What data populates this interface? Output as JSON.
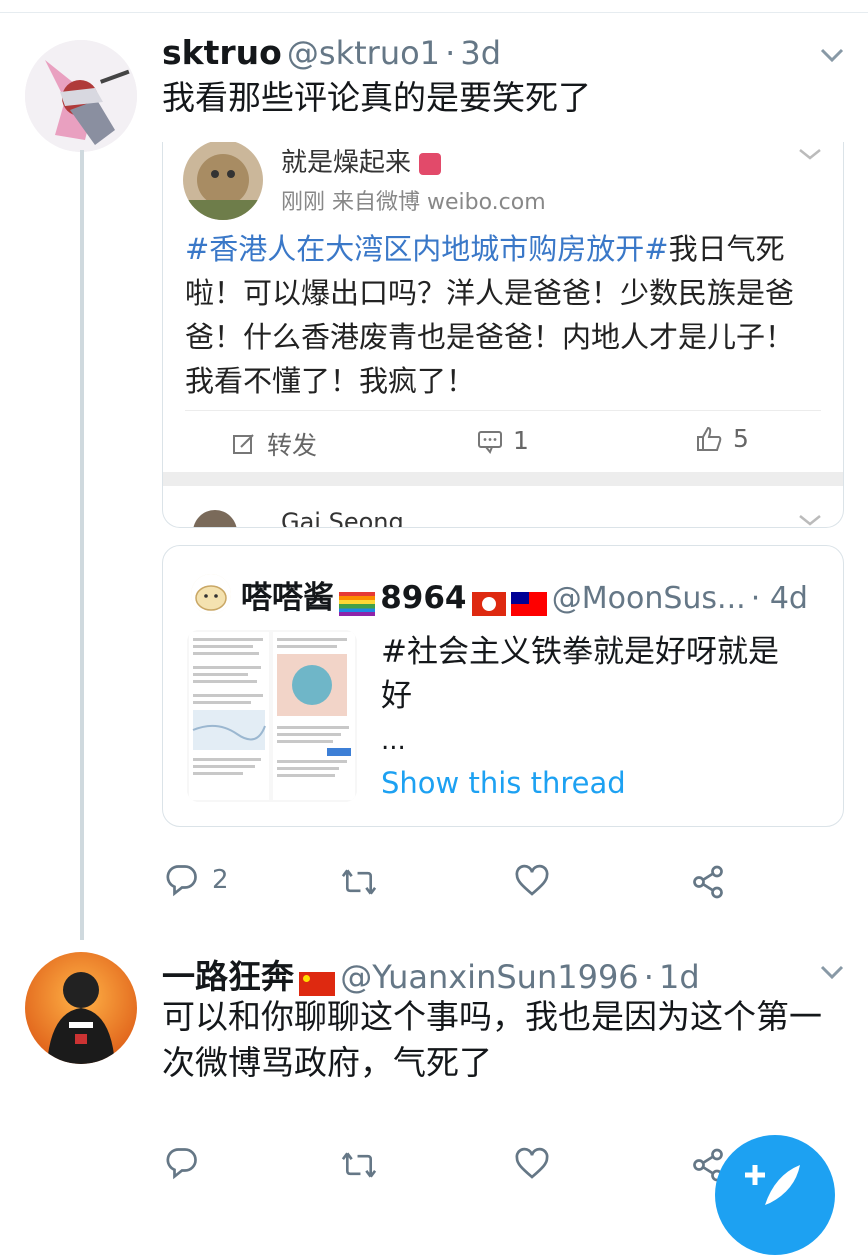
{
  "tweet1": {
    "name": "sktruo",
    "handle": "@sktruo1",
    "sep": "·",
    "time": "3d",
    "text": "我看那些评论真的是要笑死了"
  },
  "weibo": {
    "user": "就是燥起来",
    "meta": "刚刚  来自微博 weibo.com",
    "lines": [
      {
        "hash": "#香港人在大湾区内地城市购房放开#",
        "text": "我日气死"
      },
      {
        "hash": "",
        "text": "啦！可以爆出口吗？洋人是爸爸！少数民族是爸"
      },
      {
        "hash": "",
        "text": "爸！什么香港废青也是爸爸！内地人才是儿子！"
      },
      {
        "hash": "",
        "text": "我看不懂了！我疯了！"
      }
    ],
    "repost_label": "转发",
    "comment_count": "1",
    "like_count": "5",
    "next_user": "Gai Seong"
  },
  "quote": {
    "name": "嗒嗒酱",
    "name_suffix": "8964",
    "handle": "@MoonSus...",
    "time": "· 4d",
    "text_line1": "#社会主义铁拳就是好呀就是",
    "text_line2": "好",
    "ellipsis": "...",
    "show_thread": "Show this thread"
  },
  "actions1": {
    "reply_count": "2"
  },
  "tweet2": {
    "name": "一路狂奔",
    "handle": "@YuanxinSun1996",
    "sep": "·",
    "time": "1d",
    "line1": "可以和你聊聊这个事吗，我也是因为这个第一",
    "line2": "次微博骂政府，气死了"
  },
  "colors": {
    "accent": "#1da1f2",
    "secondary": "#657786",
    "weibo_link": "#3a78c8"
  },
  "icons": [
    "chevron-down-icon",
    "reply-icon",
    "retweet-icon",
    "like-icon",
    "share-icon",
    "compose-icon"
  ]
}
